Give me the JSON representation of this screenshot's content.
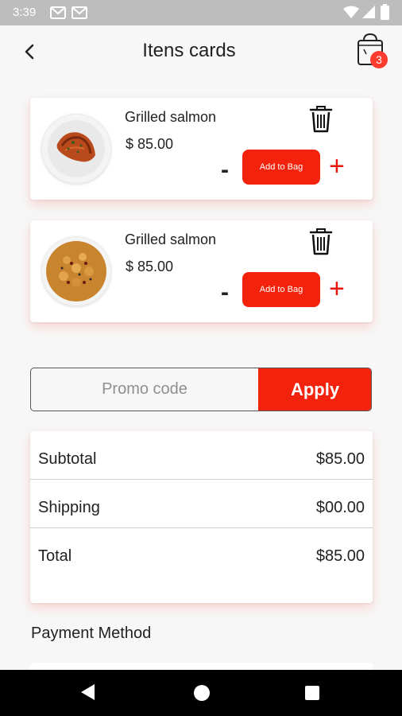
{
  "status_bar": {
    "time": "3:39",
    "icons": [
      "gmail-icon",
      "gmail-icon",
      "wifi-icon",
      "cellular-signal-icon",
      "battery-icon"
    ]
  },
  "header": {
    "title": "Itens cards",
    "back_icon": "chevron-left-icon",
    "cart_icon": "shopping-bag-icon",
    "cart_count": "3"
  },
  "items": [
    {
      "name": "Grilled salmon",
      "price": "$ 85.00",
      "image": "grilled-salmon-plate",
      "add_label": "Add to Bag",
      "minus_label": "-",
      "plus_label": "+"
    },
    {
      "name": "Grilled salmon",
      "price": "$ 85.00",
      "image": "pasta-plate",
      "add_label": "Add to Bag",
      "minus_label": "-",
      "plus_label": "+"
    }
  ],
  "promo": {
    "placeholder": "Promo code",
    "value": "",
    "apply_label": "Apply"
  },
  "summary": {
    "subtotal_label": "Subtotal",
    "subtotal_value": "$85.00",
    "shipping_label": "Shipping",
    "shipping_value": "$00.00",
    "total_label": "Total",
    "total_value": "$85.00"
  },
  "payment": {
    "heading": "Payment Method"
  },
  "colors": {
    "accent": "#f3220c",
    "background": "#f7f7f7",
    "card": "#ffffff",
    "status_bar": "#bdbdbd",
    "nav_bar": "#000000"
  }
}
